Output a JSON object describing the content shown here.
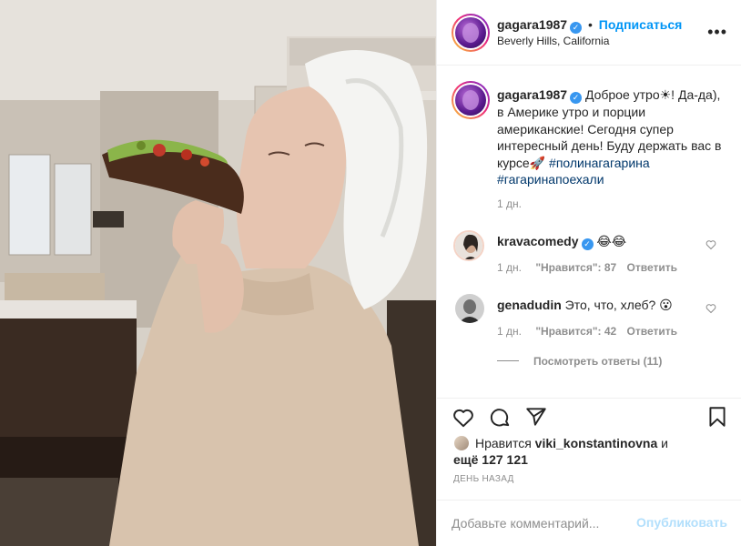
{
  "post": {
    "author": "gagara1987",
    "verified_icon": "verified-badge-icon",
    "follow_label": "Подписаться",
    "dot": "•",
    "location": "Beverly Hills, California",
    "caption": {
      "username": "gagara1987",
      "text": "Доброе утро☀! Да-да), в Америке утро и порции американские! Сегодня супер интересный день! Буду держать вас в курсе🚀",
      "hashtags": [
        "#полинагагарина",
        "#гагаринапоехали"
      ],
      "time": "1 дн."
    },
    "comments": [
      {
        "username": "kravacomedy",
        "verified": true,
        "text": "😂😂",
        "time": "1 дн.",
        "likes": "\"Нравится\": 87",
        "reply_label": "Ответить"
      },
      {
        "username": "genadudin",
        "verified": false,
        "text": "Это, что, хлеб? 😮",
        "time": "1 дн.",
        "likes": "\"Нравится\": 42",
        "reply_label": "Ответить"
      }
    ],
    "view_replies": "Посмотреть ответы (11)",
    "likes_line": {
      "prefix": "Нравится",
      "user": "viki_konstantinovna",
      "and": "и",
      "others_prefix": "ещё",
      "others_count": "127 121"
    },
    "time_ago": "ДЕНЬ НАЗАД",
    "comment_input": {
      "placeholder": "Добавьте комментарий...",
      "value": ""
    },
    "post_button": "Опубликовать"
  },
  "icons": {
    "like": "heart-icon",
    "comment": "comment-bubble-icon",
    "share": "paper-plane-icon",
    "save": "bookmark-icon",
    "more": "more-options-icon"
  },
  "colors": {
    "accent": "#0095f6",
    "hashtag": "#00376b",
    "muted": "#8e8e8e",
    "post_button_disabled": "#b2dffc"
  }
}
